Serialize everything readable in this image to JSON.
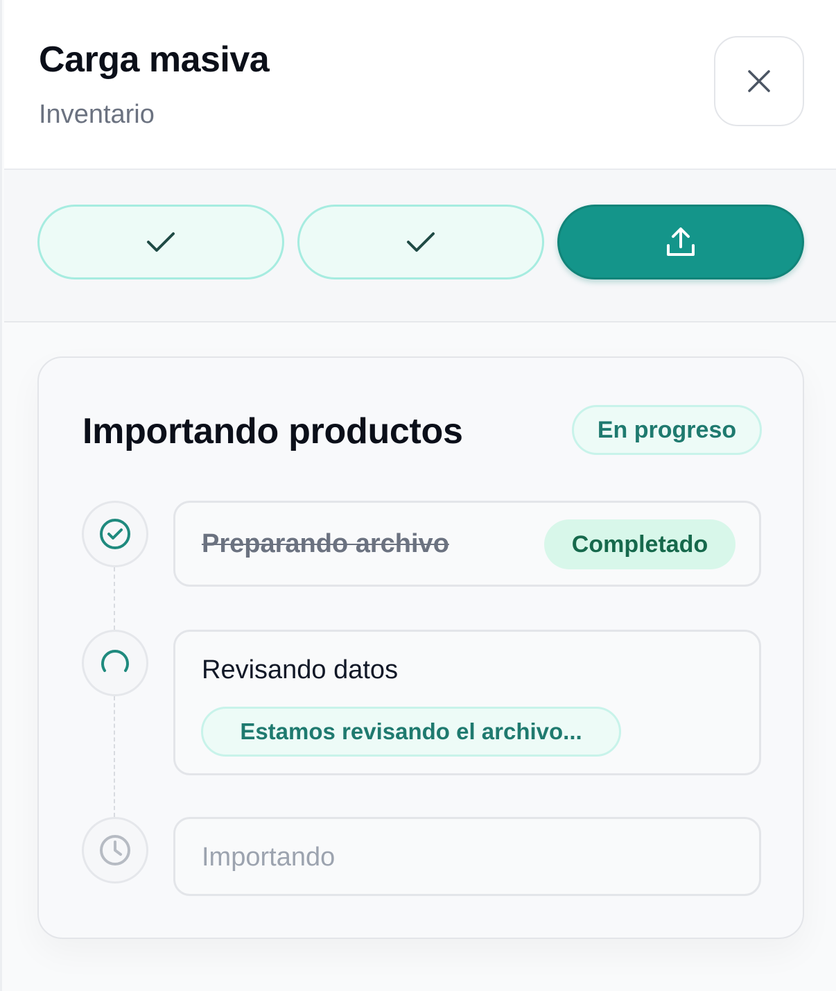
{
  "header": {
    "title": "Carga masiva",
    "subtitle": "Inventario"
  },
  "close_icon": "close-icon",
  "steps_bar": {
    "items": [
      {
        "state": "done",
        "icon": "check-icon"
      },
      {
        "state": "done",
        "icon": "check-icon"
      },
      {
        "state": "active",
        "icon": "upload-icon"
      }
    ]
  },
  "progress": {
    "title": "Importando productos",
    "status_badge": "En progreso",
    "steps": [
      {
        "label": "Preparando archivo",
        "state": "done",
        "badge": "Completado",
        "icon": "check-circle-icon"
      },
      {
        "label": "Revisando datos",
        "state": "active",
        "message": "Estamos revisando el archivo...",
        "icon": "spinner-icon"
      },
      {
        "label": "Importando",
        "state": "pending",
        "icon": "clock-icon"
      }
    ]
  },
  "colors": {
    "accent": "#14958a",
    "accent_soft": "#edfbf7",
    "success_soft": "#d8f7ea",
    "success_text": "#16694c"
  }
}
